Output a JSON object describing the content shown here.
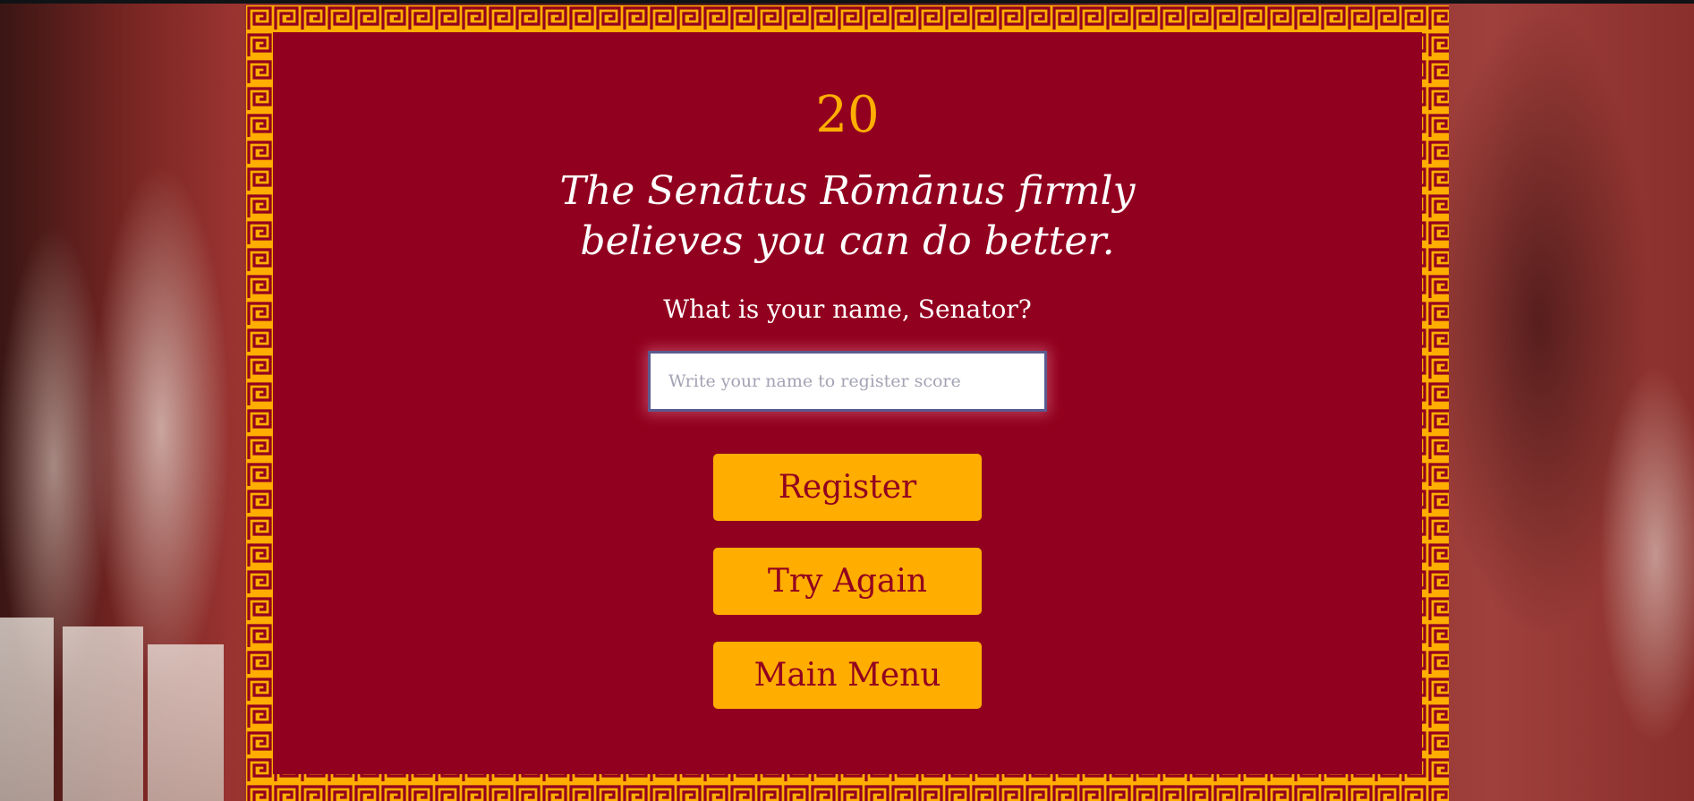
{
  "game": {
    "score": "20",
    "message": "The Senātus Rōmānus firmly believes you can do better.",
    "prompt": "What is your name, Senator?"
  },
  "form": {
    "name_placeholder": "Write your name to register score",
    "name_value": ""
  },
  "buttons": {
    "register_label": "Register",
    "try_again_label": "Try Again",
    "main_menu_label": "Main Menu"
  },
  "colors": {
    "panel": "#92001F",
    "accent": "#FFAE00",
    "text": "#FFFFFF"
  }
}
